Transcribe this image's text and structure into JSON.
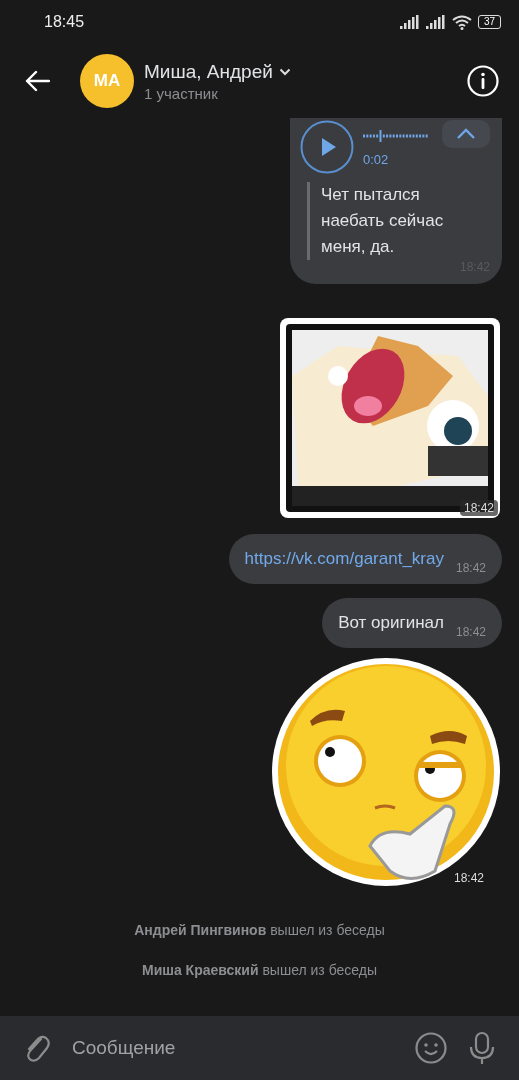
{
  "status_bar": {
    "time": "18:45",
    "battery": "37"
  },
  "header": {
    "avatar_initials": "МА",
    "title": "Миша, Андрей",
    "subtitle": "1 участник"
  },
  "messages": [
    {
      "kind": "voice",
      "duration": "0:02",
      "transcript_expanded": true,
      "transcript": "Чет пытался наебать сейчас меня, да.",
      "time": "18:42"
    },
    {
      "kind": "sticker",
      "time": "18:42"
    },
    {
      "kind": "link",
      "text": "https://vk.com/garant_kray",
      "time": "18:42"
    },
    {
      "kind": "text",
      "text": "Вот оригинал",
      "time": "18:42"
    },
    {
      "kind": "sticker",
      "time": "18:42"
    }
  ],
  "system_messages": [
    "**Андрей Пингвинов** вышел из беседы",
    "**Миша Краевский** вышел из беседы"
  ],
  "input": {
    "placeholder": "Сообщение"
  }
}
